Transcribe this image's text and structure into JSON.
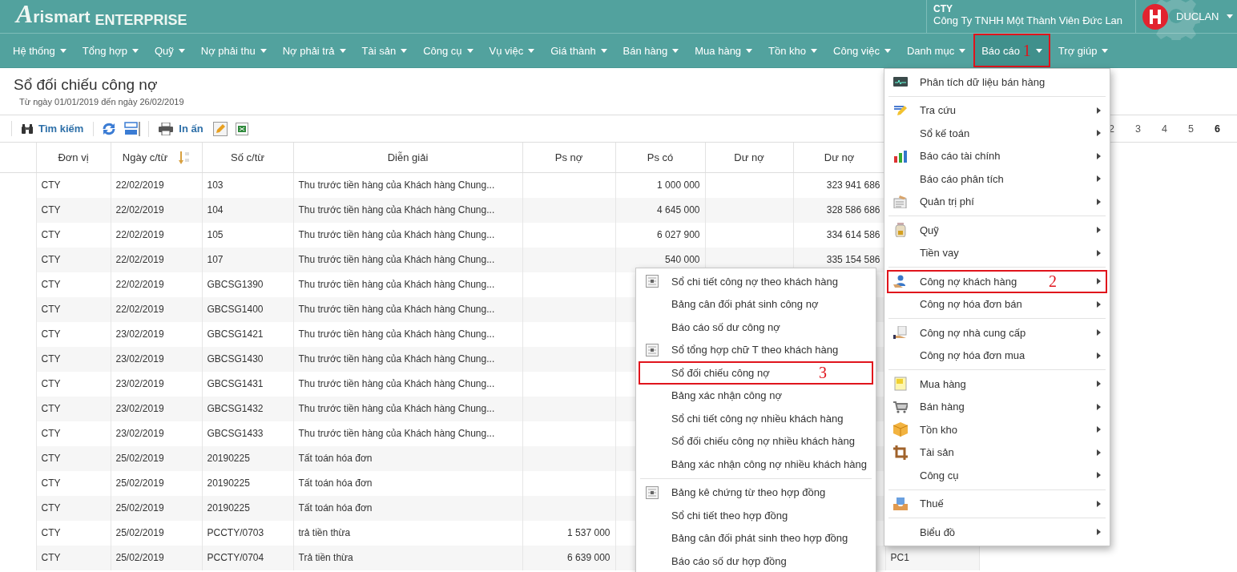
{
  "header": {
    "brand": "Arismart",
    "edition": "ENTERPRISE",
    "company_code": "CTY",
    "company_name": "Công Ty TNHH Một Thành Viên Đức Lan",
    "user": "DUCLAN"
  },
  "menu_bar": [
    {
      "label": "Hệ thống",
      "selected": false
    },
    {
      "label": "Tổng hợp",
      "selected": false
    },
    {
      "label": "Quỹ",
      "selected": false
    },
    {
      "label": "Nợ phải thu",
      "selected": false
    },
    {
      "label": "Nợ phải trả",
      "selected": false
    },
    {
      "label": "Tài sản",
      "selected": false
    },
    {
      "label": "Công cụ",
      "selected": false
    },
    {
      "label": "Vụ việc",
      "selected": false
    },
    {
      "label": "Giá thành",
      "selected": false
    },
    {
      "label": "Bán hàng",
      "selected": false
    },
    {
      "label": "Mua hàng",
      "selected": false
    },
    {
      "label": "Tồn kho",
      "selected": false
    },
    {
      "label": "Công việc",
      "selected": false
    },
    {
      "label": "Danh mục",
      "selected": false
    },
    {
      "label": "Báo cáo",
      "selected": true,
      "annotation": "1"
    },
    {
      "label": "Trợ giúp",
      "selected": false
    }
  ],
  "report": {
    "title": "Sổ đối chiếu công nợ",
    "subtitle": "Từ ngày 01/01/2019 đến ngày 26/02/2019"
  },
  "toolbar": {
    "groups": [
      [
        {
          "kind": "search",
          "label": "Tìm kiếm"
        }
      ],
      [
        {
          "kind": "refresh"
        },
        {
          "kind": "layout"
        }
      ],
      [
        {
          "kind": "print",
          "label": "In ấn"
        },
        {
          "kind": "edit"
        },
        {
          "kind": "excel"
        }
      ]
    ],
    "pages": [
      {
        "label": "2",
        "selected": false
      },
      {
        "label": "3",
        "selected": false
      },
      {
        "label": "4",
        "selected": false
      },
      {
        "label": "5",
        "selected": false
      },
      {
        "label": "6",
        "selected": true
      }
    ]
  },
  "table": {
    "columns": [
      {
        "label": "Đơn vị"
      },
      {
        "label": "Ngày c/từ",
        "sorted": true
      },
      {
        "label": "Số c/từ"
      },
      {
        "label": "Diễn giải"
      },
      {
        "label": "Ps nợ"
      },
      {
        "label": "Ps có"
      },
      {
        "label": "Dư nợ"
      },
      {
        "label": "Dư nợ"
      }
    ],
    "rows": [
      {
        "unit": "CTY",
        "date": "22/02/2019",
        "voucher": "103",
        "description": "Thu trước tiền hàng của Khách hàng Chung...",
        "credit": "1 000 000",
        "balance_2": "323 941 686"
      },
      {
        "unit": "CTY",
        "date": "22/02/2019",
        "voucher": "104",
        "description": "Thu trước tiền hàng của Khách hàng Chung...",
        "credit": "4 645 000",
        "balance_2": "328 586 686"
      },
      {
        "unit": "CTY",
        "date": "22/02/2019",
        "voucher": "105",
        "description": "Thu trước tiền hàng của Khách hàng Chung...",
        "credit": "6 027 900",
        "balance_2": "334 614 586"
      },
      {
        "unit": "CTY",
        "date": "22/02/2019",
        "voucher": "107",
        "description": "Thu trước tiền hàng của Khách hàng Chung...",
        "credit": "540 000",
        "balance_2": "335 154 586"
      },
      {
        "unit": "CTY",
        "date": "22/02/2019",
        "voucher": "GBCSG1390",
        "description": "Thu trước tiền hàng của Khách hàng Chung..."
      },
      {
        "unit": "CTY",
        "date": "22/02/2019",
        "voucher": "GBCSG1400",
        "description": "Thu trước tiền hàng của Khách hàng Chung..."
      },
      {
        "unit": "CTY",
        "date": "23/02/2019",
        "voucher": "GBCSG1421",
        "description": "Thu trước tiền hàng của Khách hàng Chung..."
      },
      {
        "unit": "CTY",
        "date": "23/02/2019",
        "voucher": "GBCSG1430",
        "description": "Thu trước tiền hàng của Khách hàng Chung..."
      },
      {
        "unit": "CTY",
        "date": "23/02/2019",
        "voucher": "GBCSG1431",
        "description": "Thu trước tiền hàng của Khách hàng Chung..."
      },
      {
        "unit": "CTY",
        "date": "23/02/2019",
        "voucher": "GBCSG1432",
        "description": "Thu trước tiền hàng của Khách hàng Chung..."
      },
      {
        "unit": "CTY",
        "date": "23/02/2019",
        "voucher": "GBCSG1433",
        "description": "Thu trước tiền hàng của Khách hàng Chung..."
      },
      {
        "unit": "CTY",
        "date": "25/02/2019",
        "voucher": "20190225",
        "description": "Tất toán hóa đơn"
      },
      {
        "unit": "CTY",
        "date": "25/02/2019",
        "voucher": "20190225",
        "description": "Tất toán hóa đơn"
      },
      {
        "unit": "CTY",
        "date": "25/02/2019",
        "voucher": "20190225",
        "description": "Tất toán hóa đơn"
      },
      {
        "unit": "CTY",
        "date": "25/02/2019",
        "voucher": "PCCTY/0703",
        "description": "trả tiền thừa",
        "debit": "1 537 000"
      },
      {
        "unit": "CTY",
        "date": "25/02/2019",
        "voucher": "PCCTY/0704",
        "description": "Trả tiền thừa",
        "debit": "6 639 000",
        "column_10": "PC1"
      }
    ]
  },
  "report_menu": {
    "groups": [
      [
        {
          "label": "Phân tích dữ liệu bán hàng",
          "kind": "monitor",
          "submenu": false
        }
      ],
      [
        {
          "label": "Tra cứu",
          "kind": "pencil",
          "submenu": true
        },
        {
          "label": "Sổ kế toán",
          "kind": "text",
          "submenu": true
        },
        {
          "label": "Báo cáo tài chính",
          "kind": "chart",
          "submenu": true
        },
        {
          "label": "Báo cáo phân tích",
          "kind": "text",
          "submenu": true
        },
        {
          "label": "Quản trị phí",
          "kind": "clipboard",
          "submenu": true
        }
      ],
      [
        {
          "label": "Quỹ",
          "kind": "jar",
          "submenu": true
        },
        {
          "label": "Tiền vay",
          "kind": "text",
          "submenu": true
        }
      ],
      [
        {
          "label": "Công nợ khách hàng",
          "kind": "person",
          "submenu": true,
          "annotation": "2"
        },
        {
          "label": "Công nợ hóa đơn bán",
          "kind": "text",
          "submenu": true
        }
      ],
      [
        {
          "label": "Công nợ nhà cung cấp",
          "kind": "receipt",
          "submenu": true
        },
        {
          "label": "Công nợ hóa đơn mua",
          "kind": "text",
          "submenu": true
        }
      ],
      [
        {
          "label": "Mua hàng",
          "kind": "note",
          "submenu": true
        },
        {
          "label": "Bán hàng",
          "kind": "cart",
          "submenu": true
        },
        {
          "label": "Tồn kho",
          "kind": "box",
          "submenu": true
        },
        {
          "label": "Tài sản",
          "kind": "crop",
          "submenu": true
        },
        {
          "label": "Công cụ",
          "kind": "text",
          "submenu": true
        }
      ],
      [
        {
          "label": "Thuế",
          "kind": "tray",
          "submenu": true
        }
      ],
      [
        {
          "label": "Biểu đồ",
          "kind": "text",
          "submenu": true
        }
      ]
    ]
  },
  "customer_debt_menu": {
    "groups": [
      [
        {
          "label": "Sổ chi tiết công nợ theo khách hàng",
          "kind": "report"
        },
        {
          "label": "Bảng cân đối phát sinh công nợ",
          "kind": "text"
        },
        {
          "label": "Báo cáo số dư công nợ",
          "kind": "text"
        },
        {
          "label": "Sổ tổng hợp chữ T theo khách hàng",
          "kind": "report"
        },
        {
          "label": "Sổ đối chiếu công nợ",
          "kind": "text",
          "annotation": "3"
        },
        {
          "label": "Bảng xác nhận công nợ",
          "kind": "text"
        },
        {
          "label": "Sổ chi tiết công nợ nhiều khách hàng",
          "kind": "text"
        },
        {
          "label": "Sổ đối chiếu công nợ nhiều khách hàng",
          "kind": "text"
        },
        {
          "label": "Bảng xác nhận công nợ nhiều khách hàng",
          "kind": "text"
        }
      ],
      [
        {
          "label": "Bảng kê chứng từ theo hợp đồng",
          "kind": "report"
        },
        {
          "label": "Sổ chi tiết theo hợp đồng",
          "kind": "text"
        },
        {
          "label": "Bảng cân đối phát sinh theo hợp đồng",
          "kind": "text"
        },
        {
          "label": "Báo cáo số dư hợp đồng",
          "kind": "text"
        }
      ]
    ]
  }
}
